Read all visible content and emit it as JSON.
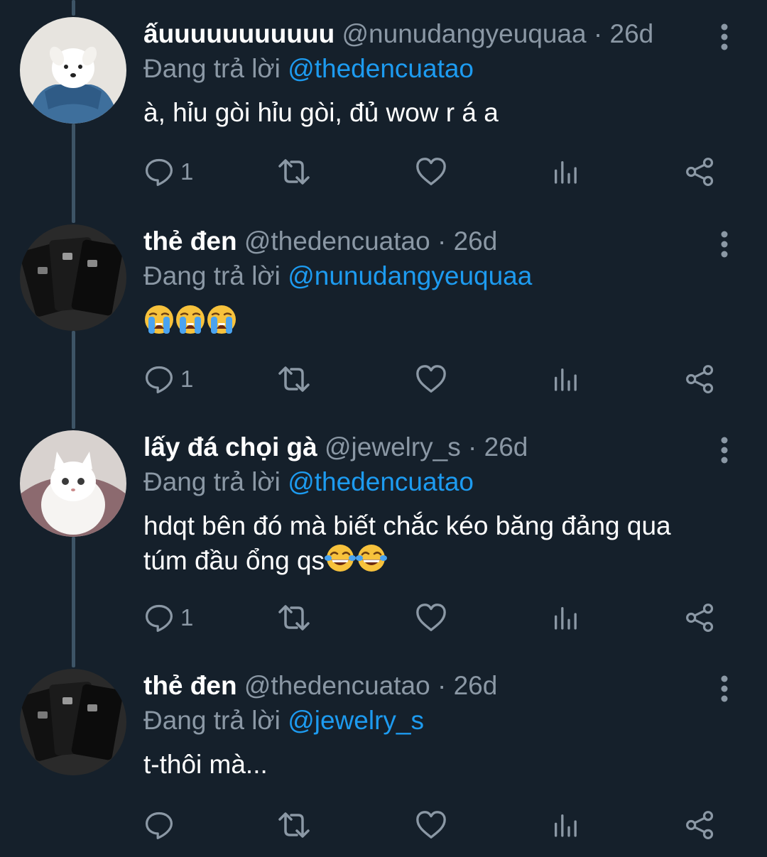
{
  "tweets": [
    {
      "display_name": "ấuuuuuuuuuuu",
      "handle": "@nunudangyeuquaa",
      "separator": "·",
      "time": "26d",
      "reply_prefix": "Đang trả lời",
      "reply_to": "@thedencuatao",
      "text": "à, hỉu gòi hỉu gòi, đủ wow r á a",
      "reply_count": "1",
      "avatar": "white-dog-photo"
    },
    {
      "display_name": "thẻ đen",
      "handle": "@thedencuatao",
      "separator": "·",
      "time": "26d",
      "reply_prefix": "Đang trả lời",
      "reply_to": "@nunudangyeuquaa",
      "text": "",
      "emojis": [
        "loudly-crying-face",
        "loudly-crying-face",
        "loudly-crying-face"
      ],
      "reply_count": "1",
      "avatar": "black-cards-photo"
    },
    {
      "display_name": "lấy đá chọi gà",
      "handle": "@jewelry_s",
      "separator": "·",
      "time": "26d",
      "reply_prefix": "Đang trả lời",
      "reply_to": "@thedencuatao",
      "text": "hdqt bên đó mà biết chắc kéo băng đảng qua túm đầu ổng qs",
      "emojis": [
        "face-with-tears-of-joy",
        "face-with-tears-of-joy"
      ],
      "reply_count": "1",
      "avatar": "white-cat-photo"
    },
    {
      "display_name": "thẻ đen",
      "handle": "@thedencuatao",
      "separator": "·",
      "time": "26d",
      "reply_prefix": "Đang trả lời",
      "reply_to": "@jewelry_s",
      "text": "t-thôi mà...",
      "reply_count": "",
      "avatar": "black-cards-photo"
    }
  ],
  "icons": {
    "reply": "speech-bubble-icon",
    "retweet": "retweet-arrows-icon",
    "like": "heart-outline-icon",
    "stats": "bar-chart-icon",
    "share": "share-nodes-icon",
    "menu": "vertical-dots-icon"
  },
  "colors": {
    "background": "#15202b",
    "text": "#ffffff",
    "muted": "#8b98a5",
    "accent": "#1d9bf0",
    "thread_line": "#3d5466"
  }
}
